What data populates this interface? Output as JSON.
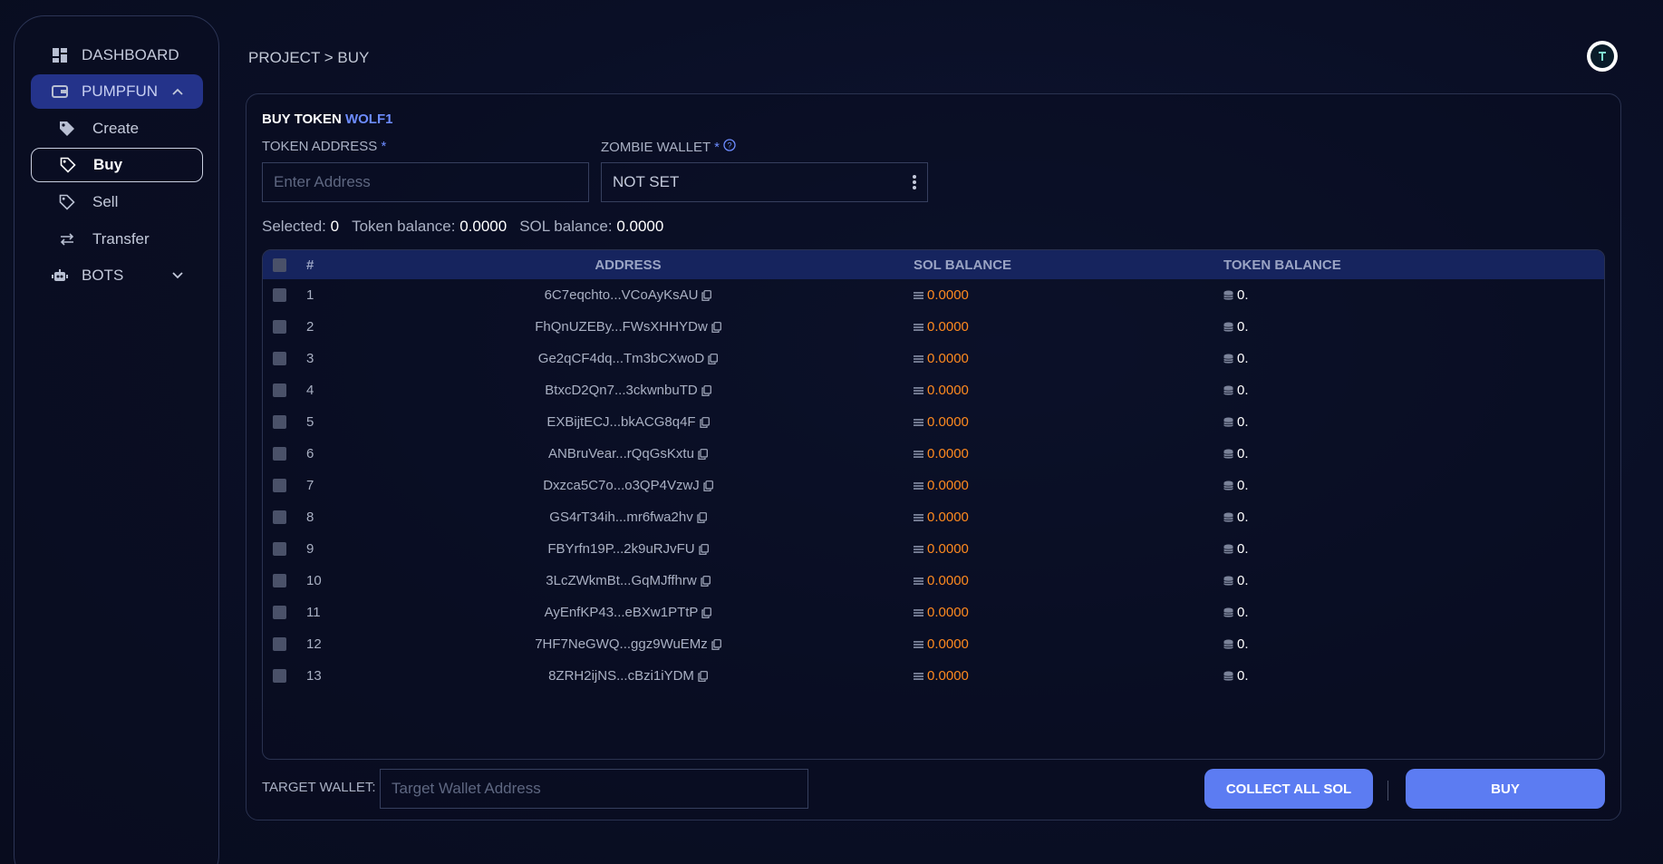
{
  "sidebar": {
    "items": [
      {
        "label": "DASHBOARD",
        "icon": "dashboard-grid-icon"
      },
      {
        "label": "PUMPFUN",
        "icon": "wallet-icon"
      },
      {
        "label": "Create",
        "icon": "tag-filled-icon"
      },
      {
        "label": "Buy",
        "icon": "tag-outline-icon"
      },
      {
        "label": "Sell",
        "icon": "tag-outline-icon"
      },
      {
        "label": "Transfer",
        "icon": "transfer-arrows-icon"
      },
      {
        "label": "BOTS",
        "icon": "robot-icon"
      }
    ],
    "social": [
      "telegram-icon",
      "twitter-icon"
    ]
  },
  "header": {
    "breadcrumb": "PROJECT > BUY",
    "avatar_icon": "avatar-logo-icon"
  },
  "panel": {
    "title_prefix": "BUY TOKEN",
    "title_token": "WOLF1",
    "token_address_label": "TOKEN ADDRESS",
    "token_address_placeholder": "Enter Address",
    "zombie_wallet_label": "ZOMBIE WALLET",
    "zombie_wallet_value": "NOT SET",
    "required_mark": "*",
    "stats": {
      "selected_label": "Selected:",
      "selected_value": "0",
      "token_balance_label": "Token balance:",
      "token_balance_value": "0.0000",
      "sol_balance_label": "SOL balance:",
      "sol_balance_value": "0.0000"
    }
  },
  "table": {
    "headers": {
      "num": "#",
      "address": "ADDRESS",
      "sol": "SOL BALANCE",
      "token": "TOKEN BALANCE"
    },
    "rows": [
      {
        "num": "1",
        "address": "6C7eqchto...VCoAyKsAU",
        "sol": "0.0000",
        "token": "0."
      },
      {
        "num": "2",
        "address": "FhQnUZEBy...FWsXHHYDw",
        "sol": "0.0000",
        "token": "0."
      },
      {
        "num": "3",
        "address": "Ge2qCF4dq...Tm3bCXwoD",
        "sol": "0.0000",
        "token": "0."
      },
      {
        "num": "4",
        "address": "BtxcD2Qn7...3ckwnbuTD",
        "sol": "0.0000",
        "token": "0."
      },
      {
        "num": "5",
        "address": "EXBijtECJ...bkACG8q4F",
        "sol": "0.0000",
        "token": "0."
      },
      {
        "num": "6",
        "address": "ANBruVear...rQqGsKxtu",
        "sol": "0.0000",
        "token": "0."
      },
      {
        "num": "7",
        "address": "Dxzca5C7o...o3QP4VzwJ",
        "sol": "0.0000",
        "token": "0."
      },
      {
        "num": "8",
        "address": "GS4rT34ih...mr6fwa2hv",
        "sol": "0.0000",
        "token": "0."
      },
      {
        "num": "9",
        "address": "FBYrfn19P...2k9uRJvFU",
        "sol": "0.0000",
        "token": "0."
      },
      {
        "num": "10",
        "address": "3LcZWkmBt...GqMJffhrw",
        "sol": "0.0000",
        "token": "0."
      },
      {
        "num": "11",
        "address": "AyEnfKP43...eBXw1PTtP",
        "sol": "0.0000",
        "token": "0."
      },
      {
        "num": "12",
        "address": "7HF7NeGWQ...ggz9WuEMz",
        "sol": "0.0000",
        "token": "0."
      },
      {
        "num": "13",
        "address": "8ZRH2ijNS...cBzi1iYDM",
        "sol": "0.0000",
        "token": "0."
      }
    ]
  },
  "footer": {
    "target_wallet_label": "TARGET WALLET:",
    "target_wallet_placeholder": "Target Wallet Address",
    "collect_button": "COLLECT ALL SOL",
    "buy_button": "BUY"
  },
  "colors": {
    "accent": "#5c7cf2",
    "sol_value": "#ff8a1f",
    "active_nav": "#24338a"
  }
}
